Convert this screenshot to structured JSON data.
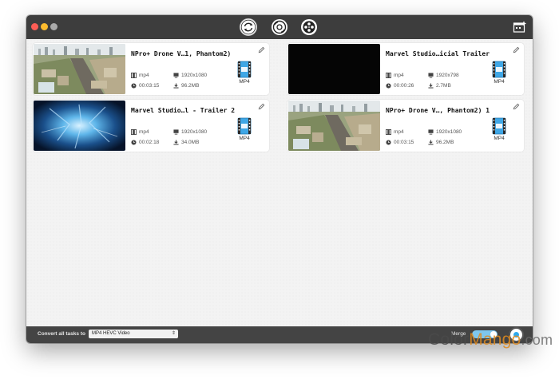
{
  "window": {
    "mode_icons": [
      "convert-icon",
      "dvd-disc-icon",
      "film-reel-icon"
    ],
    "right_icon": "add-video-icon"
  },
  "cards": [
    {
      "title": "NPro+ Drone V…1, Phantom2)",
      "format": "mp4",
      "resolution": "1920x1080",
      "duration": "00:03:15",
      "size": "96.2MB",
      "target": "MP4",
      "thumb": "city"
    },
    {
      "title": "Marvel Studio…icial Trailer",
      "format": "mp4",
      "resolution": "1920x798",
      "duration": "00:00:26",
      "size": "2.7MB",
      "target": "MP4",
      "thumb": "black"
    },
    {
      "title": "Marvel Studio…l - Trailer 2",
      "format": "mp4",
      "resolution": "1920x1080",
      "duration": "00:02:18",
      "size": "34.0MB",
      "target": "MP4",
      "thumb": "blue"
    },
    {
      "title": "NPro+ Drone V…, Phantom2) 1",
      "format": "mp4",
      "resolution": "1920x1080",
      "duration": "00:03:15",
      "size": "96.2MB",
      "target": "MP4",
      "thumb": "city"
    }
  ],
  "footer": {
    "convert_label": "Convert all tasks to",
    "convert_value": "MP4 HEVC Video",
    "merge_label": "Merge",
    "merge_on": true
  },
  "watermark": {
    "part1": "Color",
    "part2": "Mango",
    "part3": ".com"
  },
  "colors": {
    "titlebar": "#3d3d3d",
    "footer": "#444444",
    "accent": "#2fa9ec"
  }
}
